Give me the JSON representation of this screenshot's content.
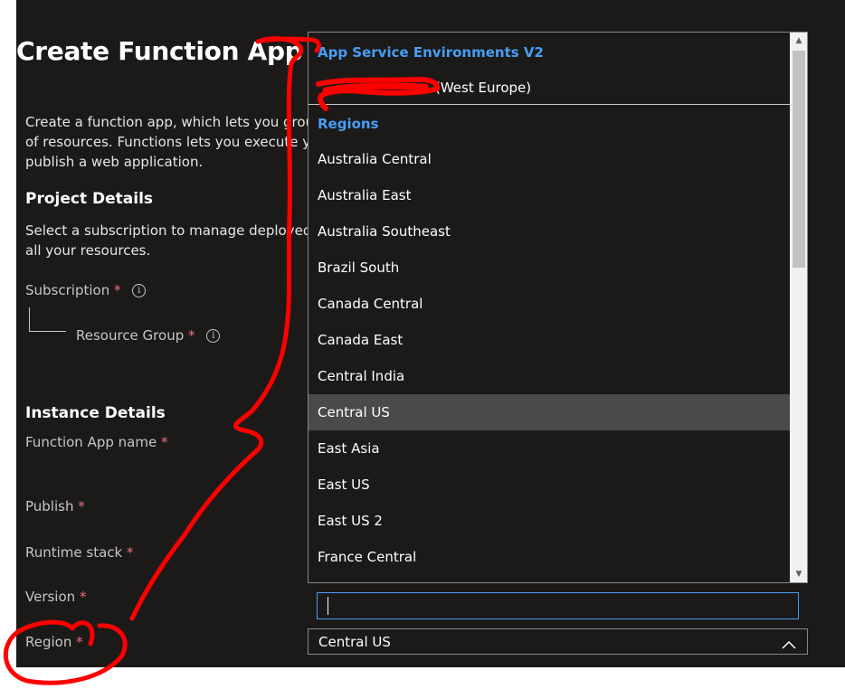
{
  "page": {
    "title": "Create Function App",
    "description_lines": [
      "Create a function app, which lets you group",
      "of resources. Functions lets you execute you",
      "publish a web application."
    ]
  },
  "project_details": {
    "heading": "Project Details",
    "description_lines": [
      "Select a subscription to manage deployed r",
      "all your resources."
    ],
    "subscription_label": "Subscription",
    "resource_group_label": "Resource Group"
  },
  "instance_details": {
    "heading": "Instance Details",
    "function_app_name_label": "Function App name",
    "publish_label": "Publish",
    "runtime_stack_label": "Runtime stack",
    "version_label": "Version",
    "region_label": "Region"
  },
  "required_marker": "*",
  "dropdown": {
    "group_ase": {
      "header": "App Service Environments V2",
      "item_suffix": "(West Europe)"
    },
    "group_regions": {
      "header": "Regions",
      "items": [
        "Australia Central",
        "Australia East",
        "Australia Southeast",
        "Brazil South",
        "Canada Central",
        "Canada East",
        "Central India",
        "Central US",
        "East Asia",
        "East US",
        "East US 2",
        "France Central"
      ],
      "selected": "Central US"
    },
    "filter_value": ""
  },
  "region_select": {
    "value": "Central US"
  },
  "colors": {
    "panel_bg": "#1b1a19",
    "accent_blue": "#479ef5",
    "selected_bg": "#4a4a4a",
    "required_red": "#f1707b",
    "annotation_red": "#ff0000"
  },
  "icons": {
    "info": "info-circle-icon",
    "chevron_up": "chevron-up-icon",
    "scroll_up": "scroll-up-arrow-icon",
    "scroll_down": "scroll-down-arrow-icon"
  }
}
